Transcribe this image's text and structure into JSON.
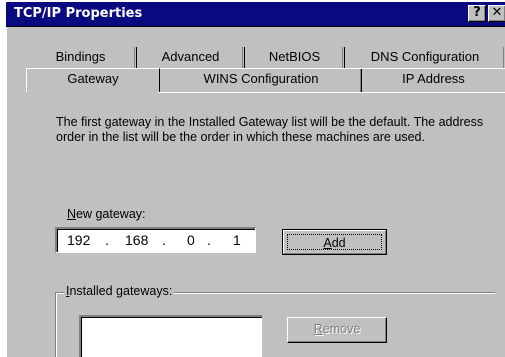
{
  "window": {
    "title": "TCP/IP Properties",
    "help_button": "?",
    "close_button": "✕"
  },
  "tabs": {
    "back_row": [
      "Bindings",
      "Advanced",
      "NetBIOS",
      "DNS Configuration"
    ],
    "front_row": [
      "Gateway",
      "WINS Configuration",
      "IP Address"
    ],
    "selected": "Gateway"
  },
  "description": "The first gateway in the Installed Gateway list will be the default. The address order in the list will be the order in which these machines are used.",
  "new_gateway": {
    "label_prefix": "N",
    "label_rest": "ew gateway:",
    "octets": [
      "192",
      "168",
      "0",
      "1"
    ],
    "separator": "."
  },
  "add_button": {
    "accel": "A",
    "rest": "dd"
  },
  "installed_gateways": {
    "label_prefix": "I",
    "label_rest": "nstalled gateways:",
    "items": []
  },
  "remove_button": {
    "accel": "R",
    "rest": "emove",
    "enabled": false
  },
  "colors": {
    "titlebar": "#0a0a80",
    "face": "#c0c0c0",
    "disabled_text": "#808080"
  }
}
